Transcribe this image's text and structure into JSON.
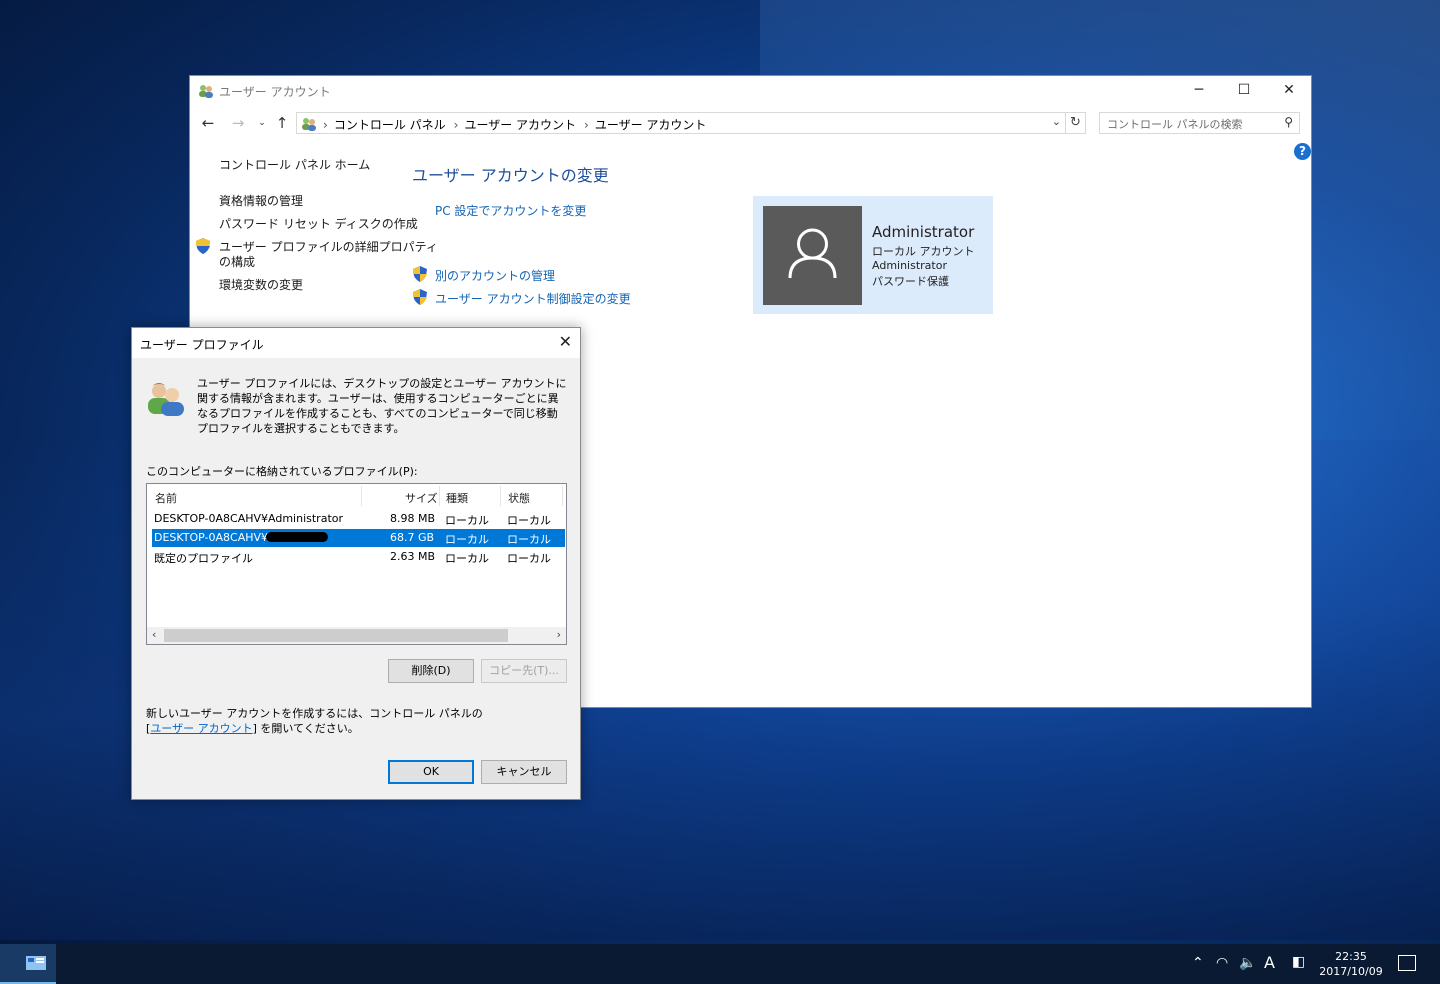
{
  "window": {
    "title": "ユーザー アカウント",
    "controls": {
      "minimize": "─",
      "maximize": "☐",
      "close": "✕"
    },
    "breadcrumbs": [
      "コントロール パネル",
      "ユーザー アカウント",
      "ユーザー アカウント"
    ],
    "search_placeholder": "コントロール パネルの検索",
    "help": "?",
    "left_nav": {
      "home": "コントロール パネル ホーム",
      "items": [
        "資格情報の管理",
        "パスワード リセット ディスクの作成",
        "ユーザー プロファイルの詳細プロパティ",
        "の構成",
        "環境変数の変更"
      ]
    },
    "main": {
      "heading": "ユーザー アカウントの変更",
      "pc_settings_link": "PC 設定でアカウントを変更",
      "manage_other_link": "別のアカウントの管理",
      "uac_link": "ユーザー アカウント制御設定の変更"
    },
    "account": {
      "name": "Administrator",
      "type": "ローカル アカウント",
      "group": "Administrator",
      "protection": "パスワード保護"
    }
  },
  "dialog": {
    "title": "ユーザー プロファイル",
    "description": "ユーザー プロファイルには、デスクトップの設定とユーザー アカウントに関する情報が含まれます。ユーザーは、使用するコンピューターごとに異なるプロファイルを作成することも、すべてのコンピューターで同じ移動プロファイルを選択することもできます。",
    "list_label": "このコンピューターに格納されているプロファイル(P):",
    "columns": [
      "名前",
      "サイズ",
      "種類",
      "状態"
    ],
    "rows": [
      {
        "name": "DESKTOP-0A8CAHV¥Administrator",
        "size": "8.98 MB",
        "type": "ローカル",
        "status": "ローカル"
      },
      {
        "name": "DESKTOP-0A8CAHV¥",
        "size": "68.7 GB",
        "type": "ローカル",
        "status": "ローカル"
      },
      {
        "name": "既定のプロファイル",
        "size": "2.63 MB",
        "type": "ローカル",
        "status": "ローカル"
      }
    ],
    "delete_button": "削除(D)",
    "copy_button": "コピー先(T)...",
    "note_line1": "新しいユーザー アカウントを作成するには、コントロール パネルの",
    "note_link": "ユーザー アカウント",
    "note_line2_suffix": " を開いてください。",
    "ok_button": "OK",
    "cancel_button": "キャンセル"
  },
  "taskbar": {
    "time": "22:35",
    "date": "2017/10/09",
    "ime": "A"
  }
}
